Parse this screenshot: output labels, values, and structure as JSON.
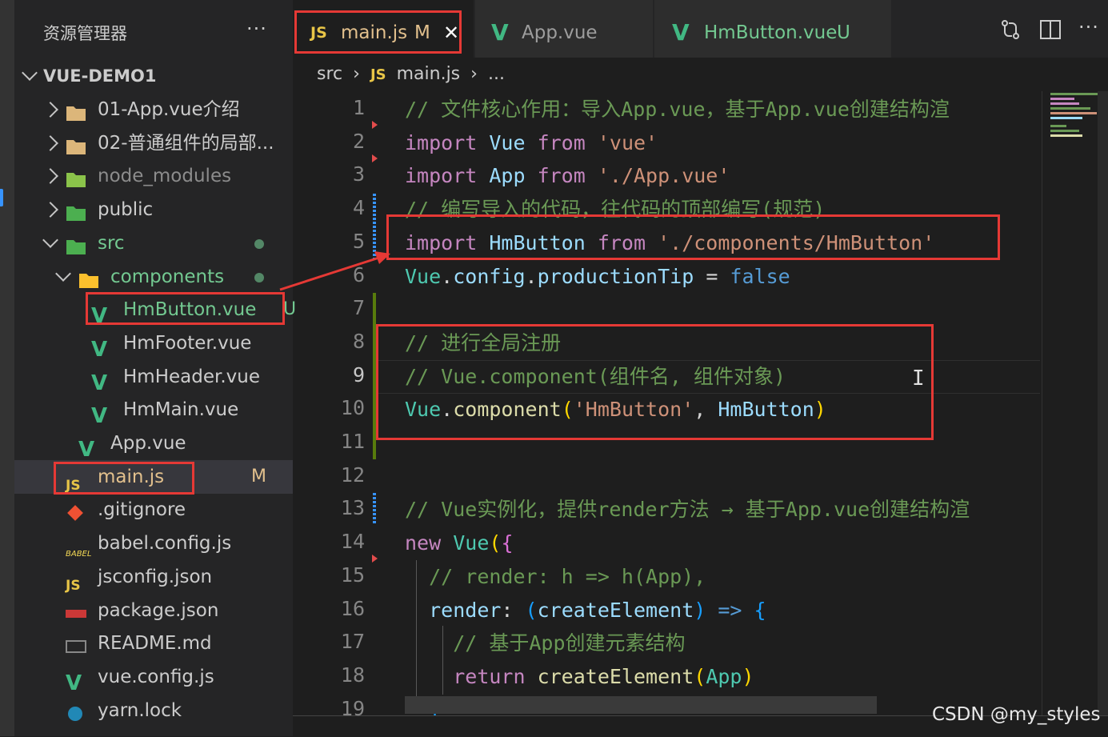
{
  "explorer": {
    "title": "资源管理器",
    "more": "···",
    "project": "VUE-DEMO1",
    "items": [
      {
        "label": "01-App.vue介绍",
        "icon": "folder-icon",
        "chevron": "right"
      },
      {
        "label": "02-普通组件的局部...",
        "icon": "folder-icon",
        "chevron": "right"
      },
      {
        "label": "node_modules",
        "icon": "node-folder-icon",
        "chevron": "right"
      },
      {
        "label": "public",
        "icon": "public-folder-icon",
        "chevron": "right"
      },
      {
        "label": "src",
        "icon": "src-folder-icon",
        "chevron": "down"
      },
      {
        "label": "components",
        "icon": "components-folder-icon",
        "chevron": "down"
      },
      {
        "label": "HmButton.vue",
        "icon": "vue-file-icon",
        "badge": "U"
      },
      {
        "label": "HmFooter.vue",
        "icon": "vue-file-icon"
      },
      {
        "label": "HmHeader.vue",
        "icon": "vue-file-icon"
      },
      {
        "label": "HmMain.vue",
        "icon": "vue-file-icon"
      },
      {
        "label": "App.vue",
        "icon": "vue-file-icon"
      },
      {
        "label": "main.js",
        "icon": "js-file-icon",
        "badge": "M"
      },
      {
        "label": ".gitignore",
        "icon": "git-icon"
      },
      {
        "label": "babel.config.js",
        "icon": "babel-icon"
      },
      {
        "label": "jsconfig.json",
        "icon": "jsconfig-icon"
      },
      {
        "label": "package.json",
        "icon": "npm-icon"
      },
      {
        "label": "README.md",
        "icon": "markdown-icon"
      },
      {
        "label": "vue.config.js",
        "icon": "vue-config-icon"
      },
      {
        "label": "yarn.lock",
        "icon": "yarn-icon"
      }
    ]
  },
  "tabs": [
    {
      "icon_text": "JS",
      "label": "main.js",
      "badge": "M",
      "close": "✕"
    },
    {
      "icon_text": "V",
      "label": "App.vue",
      "badge": ""
    },
    {
      "icon_text": "V",
      "label": "HmButton.vue",
      "badge": "U"
    }
  ],
  "breadcrumb": {
    "part1": "src",
    "sep": "›",
    "icon_text": "JS",
    "part2": "main.js",
    "part3": "..."
  },
  "code": {
    "line_numbers": [
      "1",
      "2",
      "3",
      "4",
      "5",
      "6",
      "7",
      "8",
      "9",
      "10",
      "11",
      "12",
      "13",
      "14",
      "15",
      "16",
      "17",
      "18",
      "19"
    ],
    "lines": [
      [
        [
          "cmt",
          "// 文件核心作用：导入App.vue，基于App.vue创建结构渲"
        ]
      ],
      [
        [
          "kw",
          "import "
        ],
        [
          "var",
          "Vue "
        ],
        [
          "kw",
          "from "
        ],
        [
          "str",
          "'vue'"
        ]
      ],
      [
        [
          "kw",
          "import "
        ],
        [
          "var",
          "App "
        ],
        [
          "kw",
          "from "
        ],
        [
          "str",
          "'./App.vue'"
        ]
      ],
      [
        [
          "cmt",
          "// 编写导入的代码，往代码的顶部编写(规范)"
        ]
      ],
      [
        [
          "kw",
          "import "
        ],
        [
          "var",
          "HmButton "
        ],
        [
          "kw",
          "from "
        ],
        [
          "str",
          "'./components/HmButton'"
        ]
      ],
      [
        [
          "cls",
          "Vue"
        ],
        [
          "pun",
          "."
        ],
        [
          "var",
          "config"
        ],
        [
          "pun",
          "."
        ],
        [
          "var",
          "productionTip"
        ],
        [
          "pun",
          " = "
        ],
        [
          "bool",
          "false"
        ]
      ],
      [],
      [
        [
          "cmt",
          "// 进行全局注册"
        ]
      ],
      [
        [
          "cmt",
          "// Vue.component(组件名, 组件对象)"
        ]
      ],
      [
        [
          "cls",
          "Vue"
        ],
        [
          "pun",
          "."
        ],
        [
          "fn",
          "component"
        ],
        [
          "brk1",
          "("
        ],
        [
          "str",
          "'HmButton'"
        ],
        [
          "pun",
          ", "
        ],
        [
          "var",
          "HmButton"
        ],
        [
          "brk1",
          ")"
        ]
      ],
      [],
      [],
      [
        [
          "cmt",
          "// Vue实例化，提供render方法 → 基于App.vue创建结构渲"
        ]
      ],
      [
        [
          "kw",
          "new "
        ],
        [
          "cls",
          "Vue"
        ],
        [
          "brk1",
          "("
        ],
        [
          "brk2",
          "{"
        ]
      ],
      [
        [
          "pun",
          "  "
        ],
        [
          "cmt",
          "// render: h => h(App),"
        ]
      ],
      [
        [
          "pun",
          "  "
        ],
        [
          "var",
          "render"
        ],
        [
          "pun",
          ": "
        ],
        [
          "brk3",
          "("
        ],
        [
          "var",
          "createElement"
        ],
        [
          "brk3",
          ")"
        ],
        [
          "bool",
          " => "
        ],
        [
          "brk3",
          "{"
        ]
      ],
      [
        [
          "pun",
          "    "
        ],
        [
          "cmt",
          "// 基于App创建元素结构"
        ]
      ],
      [
        [
          "pun",
          "    "
        ],
        [
          "kw",
          "return "
        ],
        [
          "fn",
          "createElement"
        ],
        [
          "brk1",
          "("
        ],
        [
          "cls",
          "App"
        ],
        [
          "brk1",
          ")"
        ]
      ],
      [
        [
          "pun",
          "  "
        ],
        [
          "brk3",
          "}"
        ]
      ]
    ]
  },
  "watermark": "CSDN @my_styles",
  "colors": {
    "annotation": "#e53935",
    "vue_green": "#41b883",
    "js_yellow": "#e8c547",
    "untracked": "#73c991",
    "modified": "#e2c08d"
  }
}
